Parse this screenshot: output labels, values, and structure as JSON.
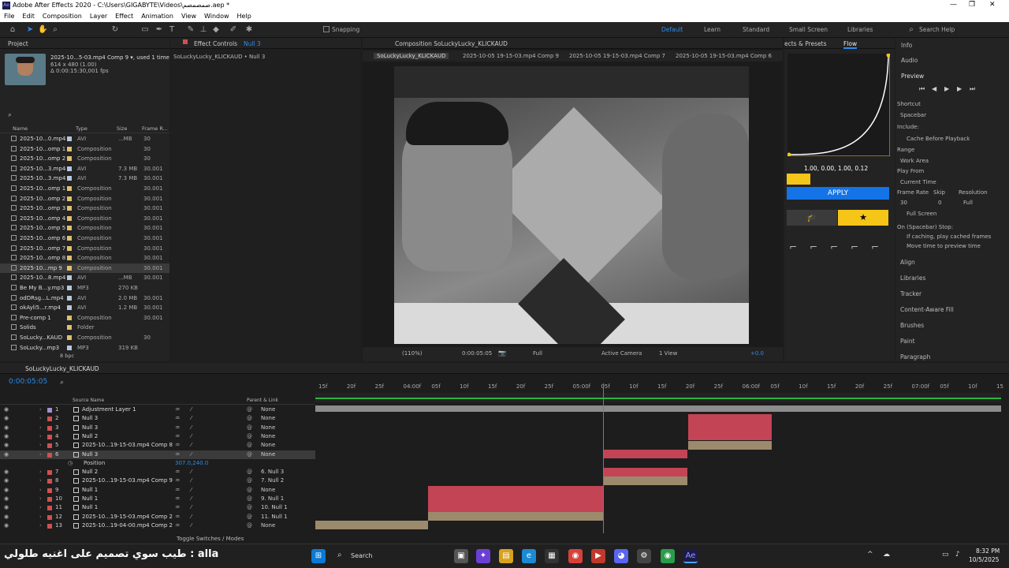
{
  "window": {
    "title": "Adobe After Effects 2020 - C:\\Users\\GIGABYTE\\Videos\\ص‍م‍ص‍م‍ص‍م.aep *"
  },
  "menu": [
    "File",
    "Edit",
    "Composition",
    "Layer",
    "Effect",
    "Animation",
    "View",
    "Window",
    "Help"
  ],
  "toolbar": {
    "snapping": "Snapping",
    "workspaces": [
      "Default",
      "Learn",
      "Standard",
      "Small Screen",
      "Libraries"
    ],
    "search_placeholder": "Search Help"
  },
  "project": {
    "tab": "Project",
    "selected_name": "2025-10...5-03.mp4 Comp 9 ▾, used 1 time",
    "selected_dims": "614 x 480 (1.00)",
    "selected_dur": "Δ 0:00:15:30,001 fps",
    "columns": [
      "Name",
      "Type",
      "Size",
      "Frame R..."
    ],
    "items": [
      {
        "name": "2025-10...0.mp4",
        "type": "AVI",
        "size": "...MB",
        "fr": "30"
      },
      {
        "name": "2025-10...omp 1",
        "type": "Composition",
        "size": "",
        "fr": "30"
      },
      {
        "name": "2025-10...omp 2",
        "type": "Composition",
        "size": "",
        "fr": "30"
      },
      {
        "name": "2025-10...3.mp4",
        "type": "AVI",
        "size": "7.3 MB",
        "fr": "30.001"
      },
      {
        "name": "2025-10...3.mp4",
        "type": "AVI",
        "size": "7.3 MB",
        "fr": "30.001"
      },
      {
        "name": "2025-10...omp 1",
        "type": "Composition",
        "size": "",
        "fr": "30.001"
      },
      {
        "name": "2025-10...omp 2",
        "type": "Composition",
        "size": "",
        "fr": "30.001"
      },
      {
        "name": "2025-10...omp 3",
        "type": "Composition",
        "size": "",
        "fr": "30.001"
      },
      {
        "name": "2025-10...omp 4",
        "type": "Composition",
        "size": "",
        "fr": "30.001"
      },
      {
        "name": "2025-10...omp 5",
        "type": "Composition",
        "size": "",
        "fr": "30.001"
      },
      {
        "name": "2025-10...omp 6",
        "type": "Composition",
        "size": "",
        "fr": "30.001"
      },
      {
        "name": "2025-10...omp 7",
        "type": "Composition",
        "size": "",
        "fr": "30.001"
      },
      {
        "name": "2025-10...omp 8",
        "type": "Composition",
        "size": "",
        "fr": "30.001"
      },
      {
        "name": "2025-10...mp 9",
        "type": "Composition",
        "size": "",
        "fr": "30.001"
      },
      {
        "name": "2025-10...8.mp4",
        "type": "AVI",
        "size": "...MB",
        "fr": "30.001"
      },
      {
        "name": "Be My B...y.mp3",
        "type": "MP3",
        "size": "270 KB",
        "fr": ""
      },
      {
        "name": "odDRsg...L.mp4",
        "type": "AVI",
        "size": "2.0 MB",
        "fr": "30.001"
      },
      {
        "name": "okAyli5...r.mp4",
        "type": "AVI",
        "size": "1.2 MB",
        "fr": "30.001"
      },
      {
        "name": "Pre-comp 1",
        "type": "Composition",
        "size": "",
        "fr": "30.001"
      },
      {
        "name": "Solids",
        "type": "Folder",
        "size": "",
        "fr": ""
      },
      {
        "name": "SoLucky...KAUD",
        "type": "Composition",
        "size": "",
        "fr": "30"
      },
      {
        "name": "SoLucky...mp3",
        "type": "MP3",
        "size": "319 KB",
        "fr": ""
      }
    ],
    "bpc": "8 bpc"
  },
  "effect_controls": {
    "tab": "Effect Controls",
    "layer": "Null 3",
    "sub": "SoLuckyLucky_KLICKAUD • Null 3"
  },
  "comp": {
    "tab": "Composition SoLuckyLucky_KLICKAUD",
    "tabs": [
      "SoLuckyLucky_KLICKAUD",
      "2025-10-05 19-15-03.mp4 Comp 9",
      "2025-10-05 19-15-03.mp4 Comp 7",
      "2025-10-05 19-15-03.mp4 Comp 6"
    ],
    "zoom": "(110%)",
    "time": "0:00:05:05",
    "quality": "Full",
    "camera": "Active Camera",
    "view": "1 View",
    "exposure": "+0.0"
  },
  "flow": {
    "tabs": [
      "ects & Presets",
      "Flow"
    ],
    "values": "1.00, 0.00, 1.00, 0.12",
    "apply": "APPLY"
  },
  "right_panel": {
    "info": "Info",
    "audio": "Audio",
    "preview": "Preview",
    "shortcut_label": "Shortcut",
    "shortcut": "Spacebar",
    "include": "Include:",
    "cache": "Cache Before Playback",
    "range_label": "Range",
    "range": "Work Area",
    "play_from_label": "Play From",
    "play_from": "Current Time",
    "frame_rate_label": "Frame Rate",
    "skip_label": "Skip",
    "resolution_label": "Resolution",
    "frame_rate": "30",
    "skip": "0",
    "resolution": "Full",
    "full_screen": "Full Screen",
    "on_stop": "On (Spacebar) Stop:",
    "if_caching": "If caching, play cached frames",
    "move_time": "Move time to preview time",
    "sections": [
      "Align",
      "Libraries",
      "Tracker",
      "Content-Aware Fill",
      "Brushes",
      "Paint",
      "Paragraph"
    ]
  },
  "timeline": {
    "tab": "SoLuckyLucky_KLICKAUD",
    "time": "0:00:05:05",
    "columns": {
      "source": "Source Name",
      "parent": "Parent & Link"
    },
    "ruler": [
      "15f",
      "20f",
      "25f",
      "04:00f",
      "05f",
      "10f",
      "15f",
      "20f",
      "25f",
      "05:00f",
      "05f",
      "10f",
      "15f",
      "20f",
      "25f",
      "06:00f",
      "05f",
      "10f",
      "15f",
      "20f",
      "25f",
      "07:00f",
      "05f",
      "10f",
      "15"
    ],
    "layers": [
      {
        "n": "1",
        "name": "Adjustment Layer 1",
        "parent": "None",
        "color": "#a78fd0"
      },
      {
        "n": "2",
        "name": "Null 3",
        "parent": "None",
        "color": "#d05050"
      },
      {
        "n": "3",
        "name": "Null 3",
        "parent": "None",
        "color": "#d05050"
      },
      {
        "n": "4",
        "name": "Null 2",
        "parent": "None",
        "color": "#d05050"
      },
      {
        "n": "5",
        "name": "2025-10...19-15-03.mp4 Comp 8",
        "parent": "None",
        "color": "#d05050"
      },
      {
        "n": "6",
        "name": "Null 3",
        "parent": "None",
        "color": "#d05050"
      },
      {
        "n": "",
        "name": "Position",
        "parent": "",
        "color": ""
      },
      {
        "n": "7",
        "name": "Null 2",
        "parent": "6. Null 3",
        "color": "#d05050"
      },
      {
        "n": "8",
        "name": "2025-10...19-15-03.mp4 Comp 9",
        "parent": "7. Null 2",
        "color": "#d05050"
      },
      {
        "n": "9",
        "name": "Null 1",
        "parent": "None",
        "color": "#d05050"
      },
      {
        "n": "10",
        "name": "Null 1",
        "parent": "9. Null 1",
        "color": "#d05050"
      },
      {
        "n": "11",
        "name": "Null 1",
        "parent": "10. Null 1",
        "color": "#d05050"
      },
      {
        "n": "12",
        "name": "2025-10...19-15-03.mp4 Comp 2",
        "parent": "11. Null 1",
        "color": "#d05050"
      },
      {
        "n": "13",
        "name": "2025-10...19-04-00.mp4 Comp 2",
        "parent": "None",
        "color": "#d05050"
      }
    ],
    "position_value": "307.0,240.0",
    "toggle": "Toggle Switches / Modes"
  },
  "taskbar": {
    "search": "Search",
    "time": "8:32 PM",
    "date": "10/5/2025",
    "caption": "طيب سوي تصميم على اغنيه طلولي : alla"
  }
}
